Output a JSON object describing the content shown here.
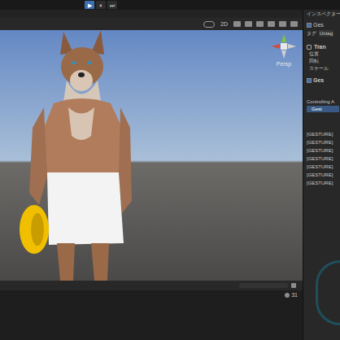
{
  "playback": [
    {
      "icon": "▶",
      "selected": true
    },
    {
      "icon": "⏸",
      "selected": false
    },
    {
      "icon": "⏭",
      "selected": false
    }
  ],
  "scene_toolbar": {
    "mode2d": "2D"
  },
  "scene": {
    "camera": "Persp"
  },
  "inspector": {
    "title": "インスペクター",
    "object_name": "Ges",
    "object_active": true,
    "tag_label": "タグ",
    "tag_value": "Untag",
    "transform": {
      "name": "Tran",
      "fields": [
        "位置",
        "回転",
        "スケール"
      ]
    },
    "component": {
      "name": "Ges",
      "enabled": true
    },
    "controlling_label": "Controlling A",
    "controlling_button": "Gest",
    "log": [
      "[GESTURE]",
      "[GESTURE]",
      "[GESTURE]",
      "[GESTURE]",
      "[GESTURE]",
      "[GESTURE]",
      "[GESTURE]"
    ]
  },
  "console": {
    "count": "31"
  }
}
